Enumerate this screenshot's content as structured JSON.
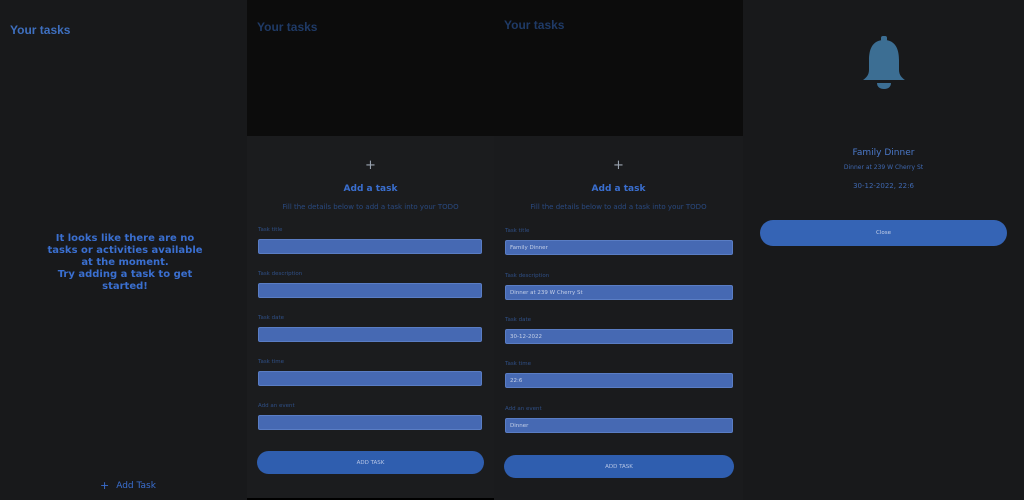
{
  "panel1": {
    "title": "Your tasks",
    "empty_message_line1": "It looks like there are no tasks or activities available at the moment.",
    "empty_message_line2": "Try adding a task to get started!",
    "add_task_label": "Add Task"
  },
  "panel2": {
    "title": "Your tasks",
    "sheet": {
      "plus": "+",
      "title": "Add a task",
      "subtitle": "Fill the details below to add a task into your TODO",
      "fields": [
        {
          "label": "Task title",
          "value": ""
        },
        {
          "label": "Task description",
          "value": ""
        },
        {
          "label": "Task date",
          "value": ""
        },
        {
          "label": "Task time",
          "value": ""
        },
        {
          "label": "Add an event",
          "value": ""
        }
      ],
      "submit_label": "ADD TASK"
    }
  },
  "panel3": {
    "title": "Your tasks",
    "sheet": {
      "plus": "+",
      "title": "Add a task",
      "subtitle": "Fill the details below to add a task into your TODO",
      "fields": [
        {
          "label": "Task title",
          "value": "Family Dinner"
        },
        {
          "label": "Task description",
          "value": "Dinner at 239 W Cherry St"
        },
        {
          "label": "Task date",
          "value": "30-12-2022"
        },
        {
          "label": "Task time",
          "value": "22:6"
        },
        {
          "label": "Add an event",
          "value": "Dinner"
        }
      ],
      "submit_label": "ADD TASK"
    }
  },
  "panel4": {
    "icon": "bell-icon",
    "title": "Family Dinner",
    "description": "Dinner at 239 W Cherry St",
    "datetime": "30-12-2022, 22:6",
    "close_label": "Close"
  },
  "colors": {
    "background": "#18191b",
    "accent": "#3a6fd0",
    "input": "#4669b3",
    "button": "#2f5eaf",
    "bell": "#3c6e93"
  }
}
